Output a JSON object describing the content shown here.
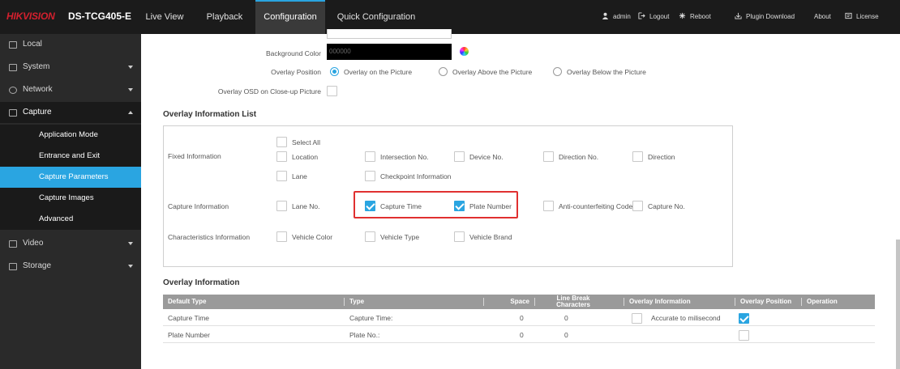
{
  "header": {
    "logo": "HIKVISION",
    "model": "DS-TCG405-E",
    "nav": [
      {
        "label": "Live View"
      },
      {
        "label": "Playback"
      },
      {
        "label": "Configuration"
      },
      {
        "label": "Quick Configuration"
      }
    ],
    "tools": {
      "user": "admin",
      "logout": "Logout",
      "reboot": "Reboot",
      "plugin": "Plugin Download",
      "about": "About",
      "license": "License"
    }
  },
  "sidebar": {
    "items": [
      {
        "label": "Local"
      },
      {
        "label": "System"
      },
      {
        "label": "Network"
      },
      {
        "label": "Capture"
      },
      {
        "label": "Video"
      },
      {
        "label": "Storage"
      }
    ],
    "capture_sub": [
      {
        "label": "Application Mode"
      },
      {
        "label": "Entrance and Exit"
      },
      {
        "label": "Capture Parameters"
      },
      {
        "label": "Capture Images"
      },
      {
        "label": "Advanced"
      }
    ]
  },
  "settings": {
    "bg_color_label": "Background Color",
    "bg_color_value": "000000",
    "overlay_position_label": "Overlay Position",
    "overlay_position_options": [
      "Overlay on the Picture",
      "Overlay Above the Picture",
      "Overlay Below the Picture"
    ],
    "overlay_position_selected": "Overlay on the Picture",
    "osd_closeup_label": "Overlay OSD on Close-up Picture"
  },
  "overlay_list": {
    "title": "Overlay Information List",
    "select_all": "Select All",
    "fixed_label": "Fixed Information",
    "fixed_items": [
      "Location",
      "Intersection No.",
      "Device No.",
      "Direction No.",
      "Direction",
      "Lane",
      "Checkpoint Information"
    ],
    "capture_label": "Capture Information",
    "capture_items": [
      "Lane No.",
      "Capture Time",
      "Plate Number",
      "Anti-counterfeiting Code",
      "Capture No."
    ],
    "characteristics_label": "Characteristics Information",
    "characteristics_items": [
      "Vehicle Color",
      "Vehicle Type",
      "Vehicle Brand"
    ]
  },
  "overlay_info": {
    "title": "Overlay Information",
    "columns": {
      "default_type": "Default Type",
      "type": "Type",
      "space": "Space",
      "line_break_1": "Line Break",
      "line_break_2": "Characters",
      "overlay_information": "Overlay Information",
      "overlay_position": "Overlay Position",
      "operation": "Operation"
    },
    "rows": [
      {
        "default_type": "Capture Time",
        "type": "Capture Time:",
        "space": "0",
        "line_break": "0",
        "overlay_info": "Accurate to milisecond",
        "overlay_position_checked": true
      },
      {
        "default_type": "Plate Number",
        "type": "Plate No.:",
        "space": "0",
        "line_break": "0",
        "overlay_info": "",
        "overlay_position_checked": false
      }
    ]
  },
  "colors": {
    "accent": "#2aa5e1",
    "highlight_red": "#e03030",
    "topbar": "#1b1b1b",
    "sidebar": "#2a2a2a"
  }
}
